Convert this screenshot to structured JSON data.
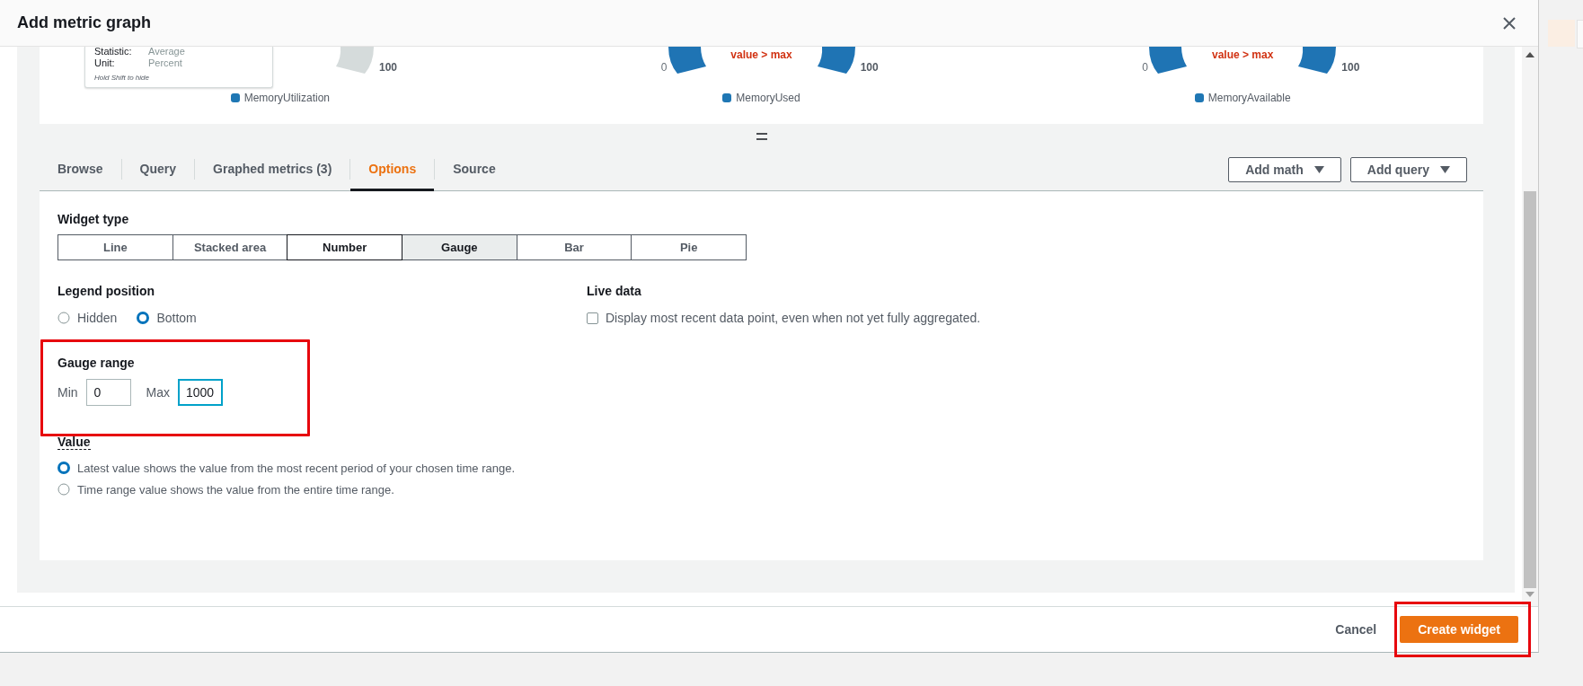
{
  "dialog": {
    "title": "Add metric graph"
  },
  "preview": {
    "tooltip": {
      "rows": [
        {
          "label": "Statistic:",
          "value": "Average"
        },
        {
          "label": "Unit:",
          "value": "Percent"
        }
      ],
      "hint": "Hold Shift to hide"
    },
    "gauges": [
      {
        "kind": "empty",
        "max_label": "100",
        "legend": "MemoryUtilization"
      },
      {
        "kind": "over",
        "min_label": "0",
        "max_label": "100",
        "warning": "value > max",
        "legend": "MemoryUsed"
      },
      {
        "kind": "over",
        "min_label": "0",
        "max_label": "100",
        "warning": "value > max",
        "legend": "MemoryAvailable"
      }
    ]
  },
  "tabs": [
    {
      "label": "Browse",
      "selected": false
    },
    {
      "label": "Query",
      "selected": false
    },
    {
      "label": "Graphed metrics (3)",
      "selected": false
    },
    {
      "label": "Options",
      "selected": true
    },
    {
      "label": "Source",
      "selected": false
    }
  ],
  "tab_actions": [
    {
      "label": "Add math"
    },
    {
      "label": "Add query"
    }
  ],
  "options": {
    "widget_type": {
      "label": "Widget type",
      "items": [
        {
          "label": "Line",
          "selected": false,
          "focused": false
        },
        {
          "label": "Stacked area",
          "selected": false,
          "focused": false
        },
        {
          "label": "Number",
          "selected": false,
          "focused": true
        },
        {
          "label": "Gauge",
          "selected": true,
          "focused": false
        },
        {
          "label": "Bar",
          "selected": false,
          "focused": false
        },
        {
          "label": "Pie",
          "selected": false,
          "focused": false
        }
      ]
    },
    "legend_position": {
      "label": "Legend position",
      "options": [
        {
          "label": "Hidden",
          "selected": false
        },
        {
          "label": "Bottom",
          "selected": true
        }
      ]
    },
    "live_data": {
      "label": "Live data",
      "checkbox": {
        "label": "Display most recent data point, even when not yet fully aggregated.",
        "checked": false
      }
    },
    "gauge_range": {
      "label": "Gauge range",
      "highlighted": true,
      "fields": [
        {
          "label": "Min",
          "value": "0",
          "focused": false
        },
        {
          "label": "Max",
          "value": "1000",
          "focused": true
        }
      ]
    },
    "value": {
      "label": "Value",
      "options": [
        {
          "label": "Latest value shows the value from the most recent period of your chosen time range.",
          "selected": true
        },
        {
          "label": "Time range value shows the value from the entire time range.",
          "selected": false
        }
      ]
    }
  },
  "footer": {
    "buttons": [
      {
        "label": "Cancel",
        "kind": "link"
      },
      {
        "label": "Create widget",
        "kind": "primary",
        "highlighted": true
      }
    ]
  }
}
